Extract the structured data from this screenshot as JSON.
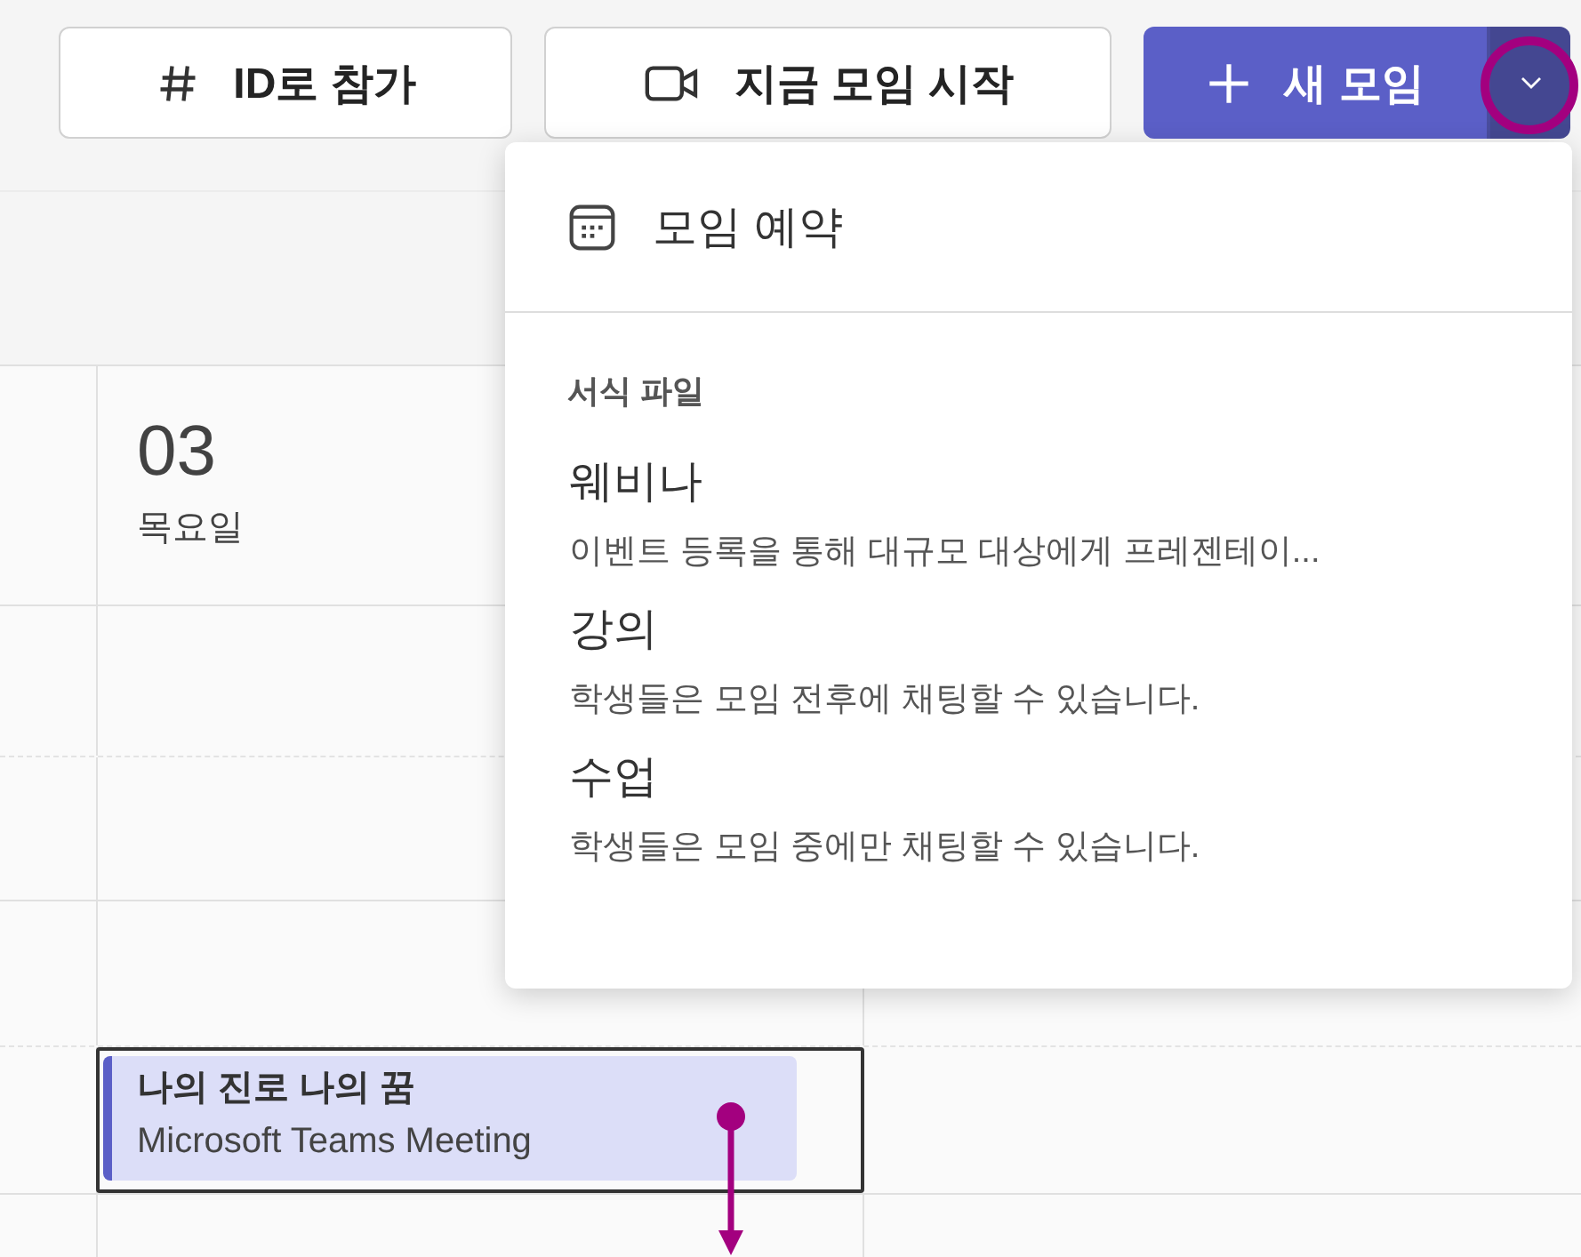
{
  "toolbar": {
    "buttons": [
      {
        "kind": "hash",
        "label": "ID로 참가"
      },
      {
        "kind": "video",
        "label": "지금 모임 시작"
      }
    ],
    "new_meeting": {
      "label": "새 모임",
      "expanded": true
    }
  },
  "menu": {
    "schedule": {
      "label": "모임 예약"
    },
    "section_title": "서식 파일",
    "templates": [
      {
        "title": "웨비나",
        "description": "이벤트 등록을 통해 대규모 대상에게 프레젠테이..."
      },
      {
        "title": "강의",
        "description": "학생들은 모임 전후에 채팅할 수 있습니다."
      },
      {
        "title": "수업",
        "description": "학생들은 모임 중에만 채팅할 수 있습니다."
      }
    ]
  },
  "calendar": {
    "day": {
      "date": "03",
      "weekday": "목요일"
    },
    "event": {
      "title": "나의 진로 나의 꿈",
      "subtitle": "Microsoft Teams Meeting",
      "selected": true
    }
  }
}
